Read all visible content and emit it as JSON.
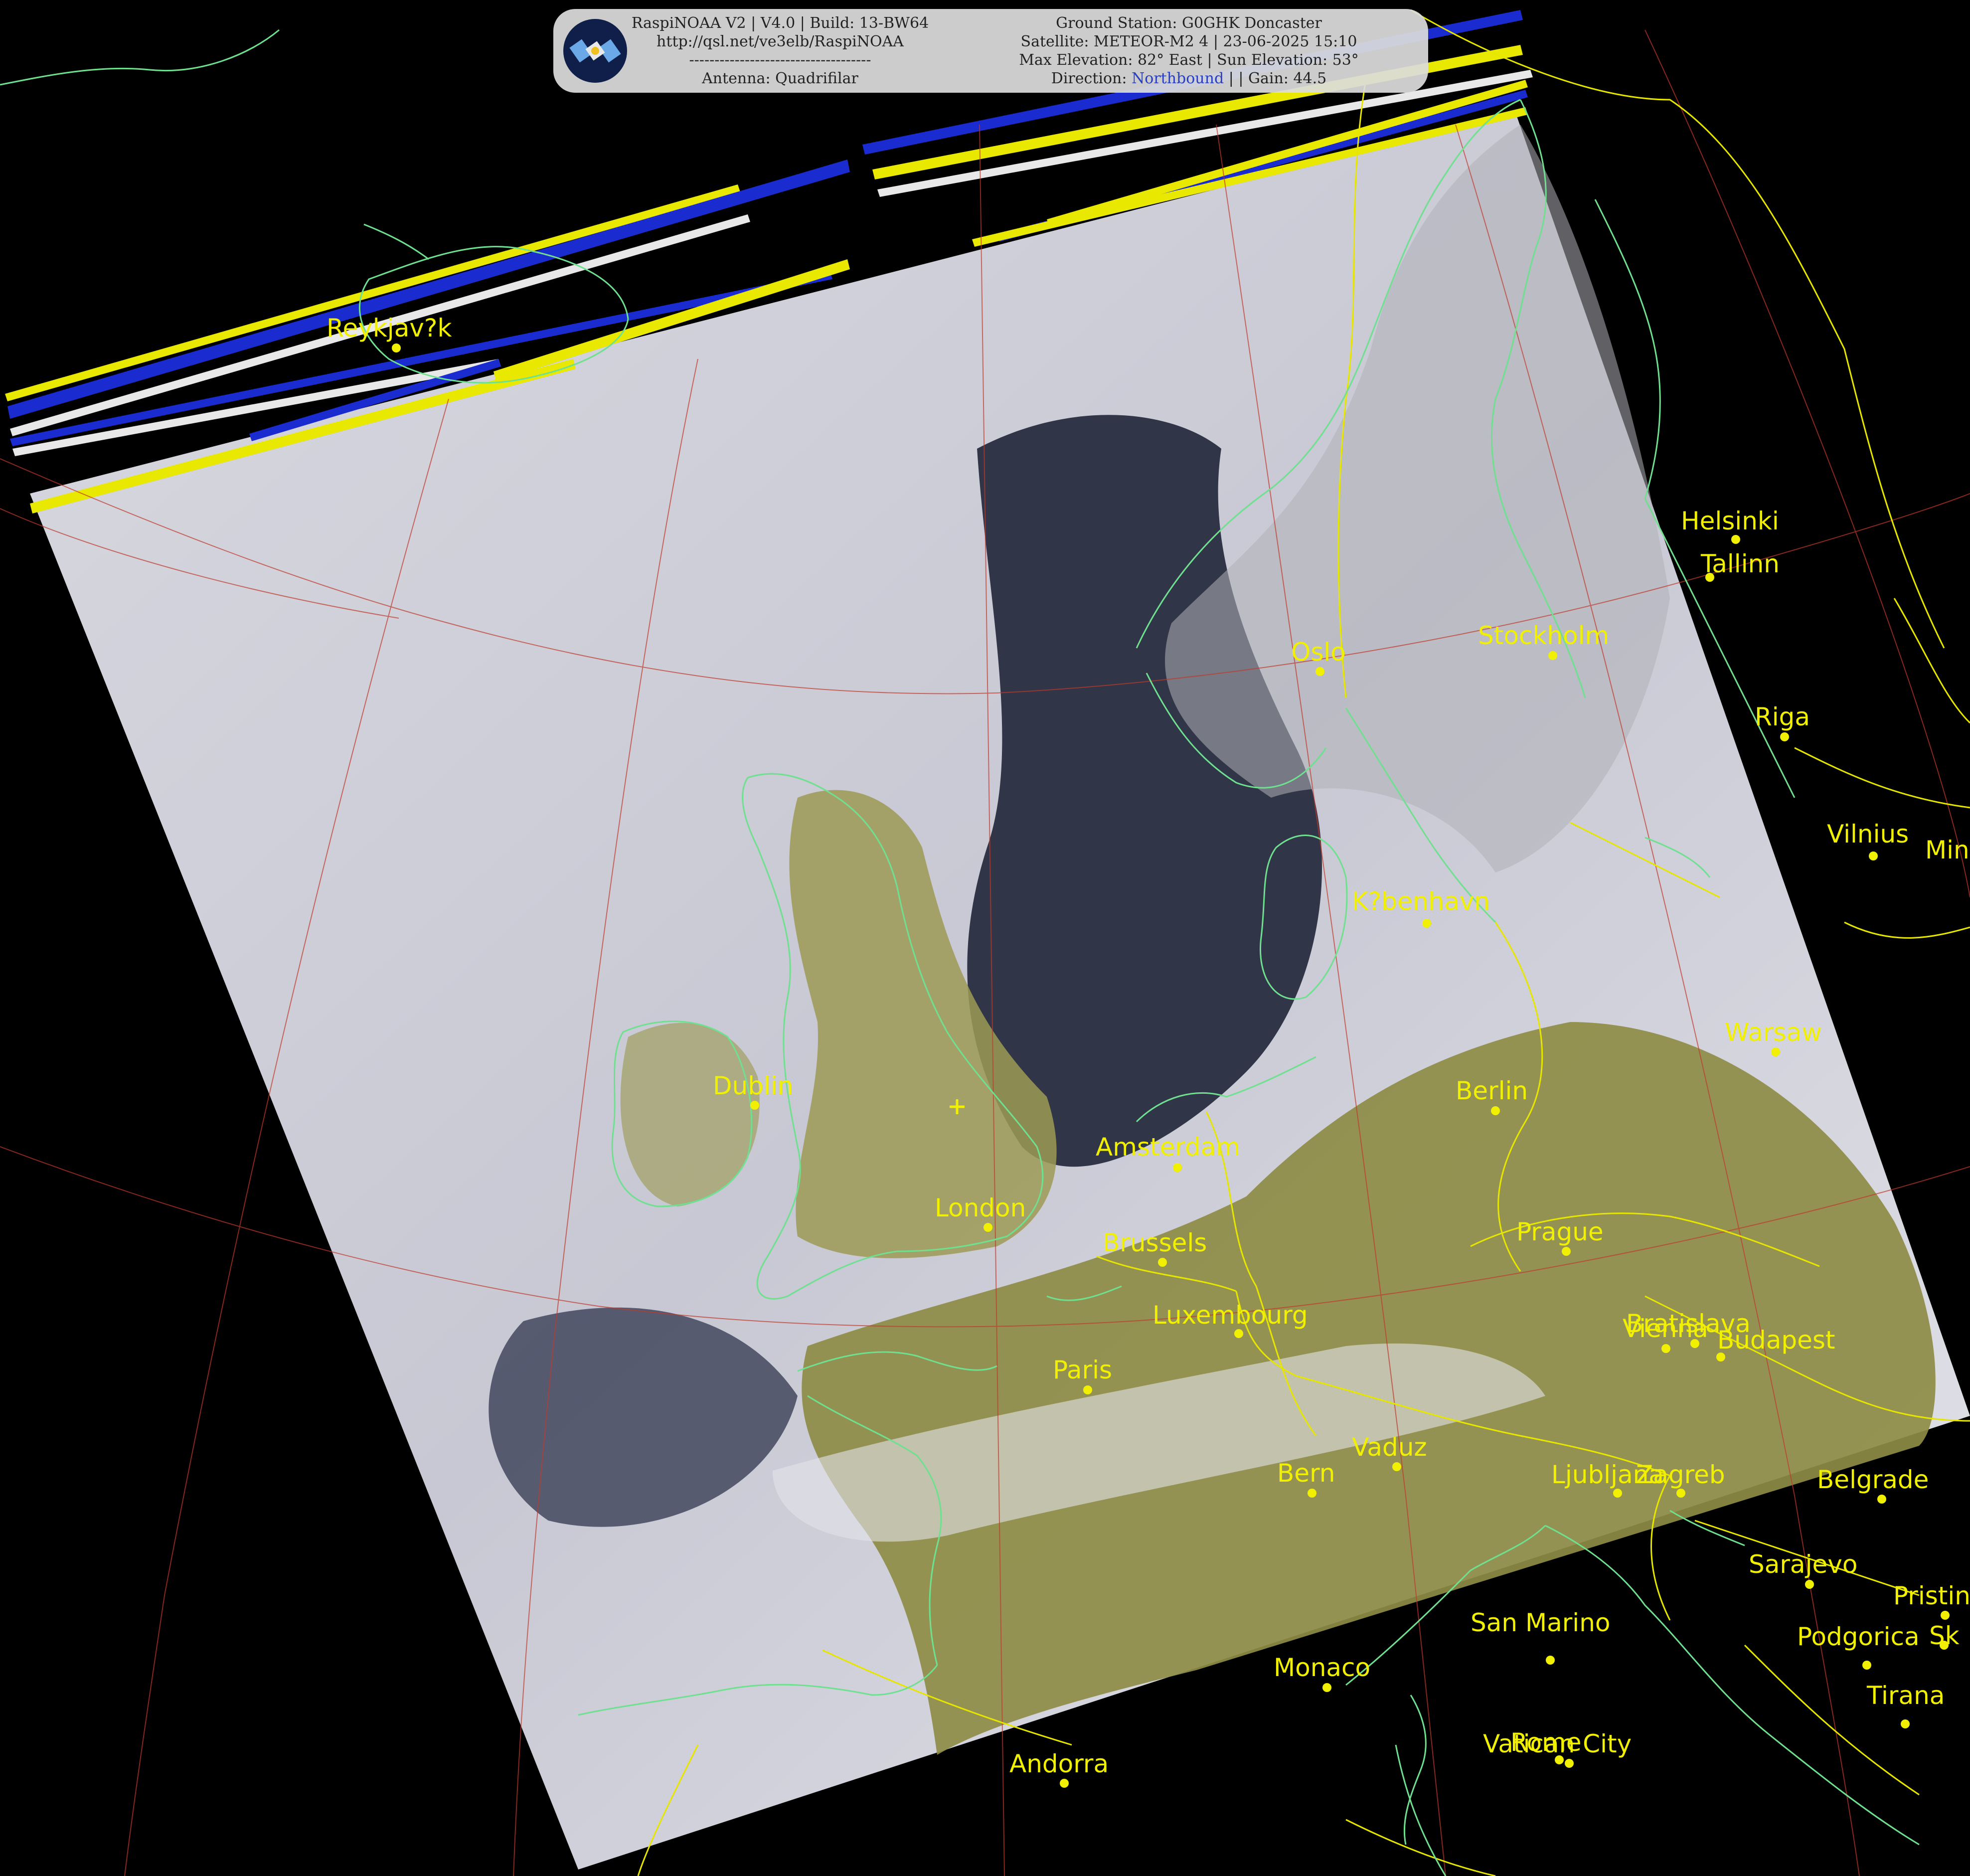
{
  "banner": {
    "software": "RaspiNOAA V2 | V4.0 | Build: 13-BW64",
    "url": "http://qsl.net/ve3elb/RaspiNOAA",
    "separator": "------------------------------------",
    "antenna": "Antenna: Quadrifilar",
    "station": "Ground Station: G0GHK Doncaster",
    "satellite": "Satellite: METEOR-M2 4 | 23-06-2025 15:10",
    "elevation": "Max Elevation: 82° East | Sun Elevation: 53°",
    "direction_prefix": "Direction: ",
    "direction_word": "Northbound",
    "direction_suffix": " | | Gain: 44.5",
    "logo_icon": "satellite-icon"
  },
  "colors": {
    "label": "#f0f000",
    "coastline": "#6fe08f",
    "border": "#e6e600",
    "graticule": "#c0392b",
    "sea": "#1e2236",
    "land": "#8c8a3e",
    "cloud": "#dcdce6"
  },
  "cities": [
    {
      "name": "Reykjav?k"
    },
    {
      "name": "Helsinki"
    },
    {
      "name": "Tallinn"
    },
    {
      "name": "Oslo"
    },
    {
      "name": "Stockholm"
    },
    {
      "name": "Riga"
    },
    {
      "name": "Vilnius"
    },
    {
      "name": "Min"
    },
    {
      "name": "K?benhavn"
    },
    {
      "name": "Warsaw"
    },
    {
      "name": "Dublin"
    },
    {
      "name": "Berlin"
    },
    {
      "name": "Amsterdam"
    },
    {
      "name": "London"
    },
    {
      "name": "Brussels"
    },
    {
      "name": "Prague"
    },
    {
      "name": "Luxembourg"
    },
    {
      "name": "Bratislava"
    },
    {
      "name": "Vienna"
    },
    {
      "name": "Budapest"
    },
    {
      "name": "Paris"
    },
    {
      "name": "Vaduz"
    },
    {
      "name": "Bern"
    },
    {
      "name": "Ljubljana"
    },
    {
      "name": "Zagreb"
    },
    {
      "name": "Belgrade"
    },
    {
      "name": "Sarajevo"
    },
    {
      "name": "Pristin"
    },
    {
      "name": "San Marino"
    },
    {
      "name": "Podgorica"
    },
    {
      "name": "Sk"
    },
    {
      "name": "Monaco"
    },
    {
      "name": "Tirana"
    },
    {
      "name": "Vatican City"
    },
    {
      "name": "Rome"
    },
    {
      "name": "Andorra"
    }
  ]
}
